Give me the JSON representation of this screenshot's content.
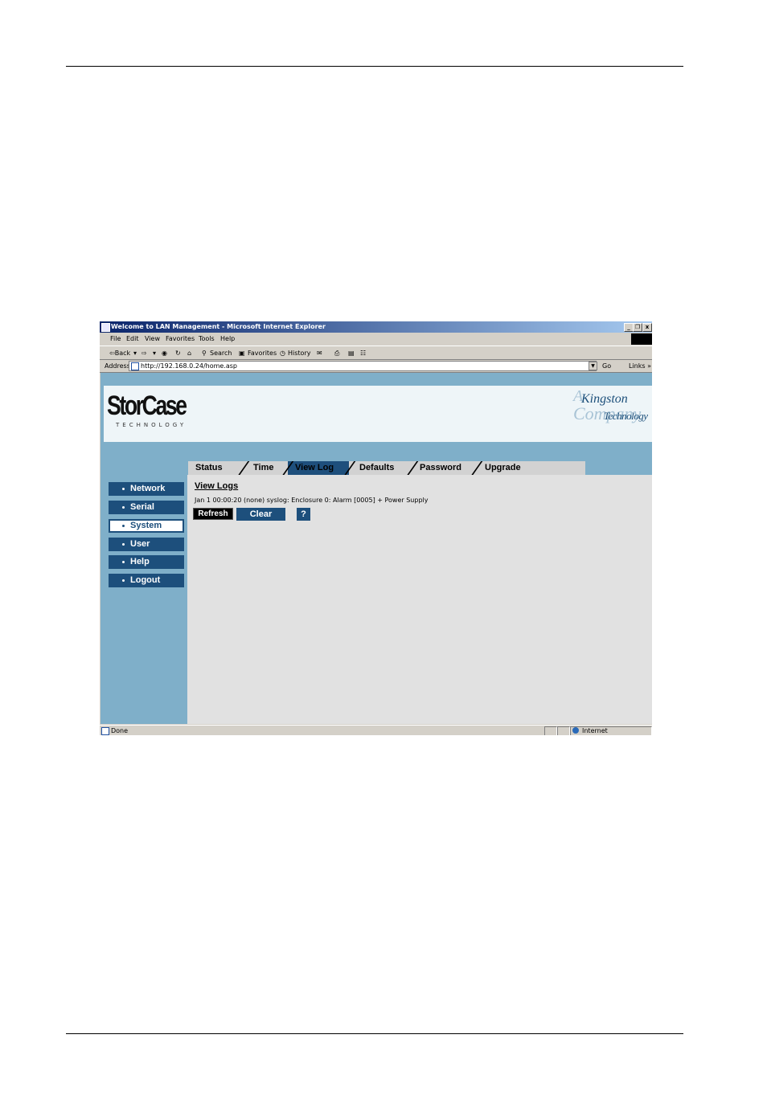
{
  "window": {
    "title": "Welcome to LAN Management - Microsoft Internet Explorer",
    "controls": [
      "_",
      "ɠ",
      "x"
    ]
  },
  "menu": [
    "File",
    "Edit",
    "View",
    "Favorites",
    "Tools",
    "Help"
  ],
  "toolbar": {
    "back": "⇦Back",
    "forward": "⇨",
    "search": "Search",
    "favorites": "Favorites",
    "history": "History"
  },
  "address": {
    "label": "Address",
    "url": "http://192.168.0.24/home.asp",
    "go": "Go",
    "links": "Links »"
  },
  "logo": {
    "brand": "StorCase",
    "tagline": "TECHNOLOGY",
    "partner_a": "A",
    "partner_kingston": "Kingston",
    "partner_company": "Company",
    "partner_technology": "Technology"
  },
  "tabs": [
    {
      "label": "Status",
      "active": false
    },
    {
      "label": "Time",
      "active": false
    },
    {
      "label": "View Log",
      "active": true
    },
    {
      "label": "Defaults",
      "active": false
    },
    {
      "label": "Password",
      "active": false
    },
    {
      "label": "Upgrade",
      "active": false
    }
  ],
  "sidebar": [
    {
      "label": "Network",
      "active": false
    },
    {
      "label": "Serial",
      "active": false
    },
    {
      "label": "System",
      "active": true
    },
    {
      "label": "User",
      "active": false
    },
    {
      "label": "Help",
      "active": false
    },
    {
      "label": "Logout",
      "active": false
    }
  ],
  "content": {
    "heading": "View Logs",
    "log_line": "Jan 1 00:00:20 (none) syslog: Enclosure 0: Alarm [0005] + Power Supply",
    "refresh_label": "Refresh",
    "clear_label": "Clear",
    "help_label": "?"
  },
  "status": {
    "text": "Done",
    "zone": "Internet"
  },
  "colors": {
    "page_bg": "#7fafc9",
    "nav_button": "#1d4f7c",
    "content_bg": "#e1e1e1"
  }
}
